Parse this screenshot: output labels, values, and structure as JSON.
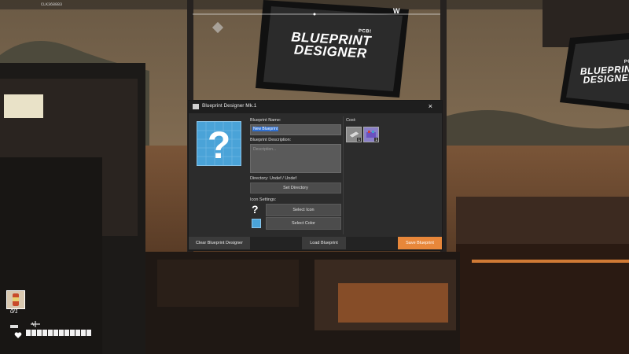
{
  "hud": {
    "top_id": "CLK368883",
    "compass_letter": "W",
    "item_count": "0/1",
    "health_segments": 12
  },
  "monitors": {
    "brand": "PCB!",
    "line1": "BLUEPRINT",
    "line2": "DESIGNER"
  },
  "dialog": {
    "title": "Blueprint Designer Mk.1",
    "close_symbol": "×",
    "name_label": "Blueprint Name:",
    "name_value": "New Blueprint",
    "description_label": "Blueprint Description:",
    "description_placeholder": "Description...",
    "directory_label": "Directory: Undef / Undef",
    "set_directory_button": "Set Directory",
    "icon_settings_label": "Icon Settings:",
    "select_icon_button": "Select Icon",
    "select_color_button": "Select Color",
    "cost_label": "Cost:",
    "cost_items": [
      {
        "icon": "metal-plate-icon",
        "count": "1"
      },
      {
        "icon": "circuit-board-icon",
        "count": "1"
      }
    ],
    "clear_button": "Clear Blueprint Designer",
    "load_button": "Load Blueprint",
    "save_button": "Save Blueprint"
  },
  "colors": {
    "accent": "#e8873a",
    "icon_blue": "#4aa3d8",
    "selection": "#2f6fd0"
  }
}
